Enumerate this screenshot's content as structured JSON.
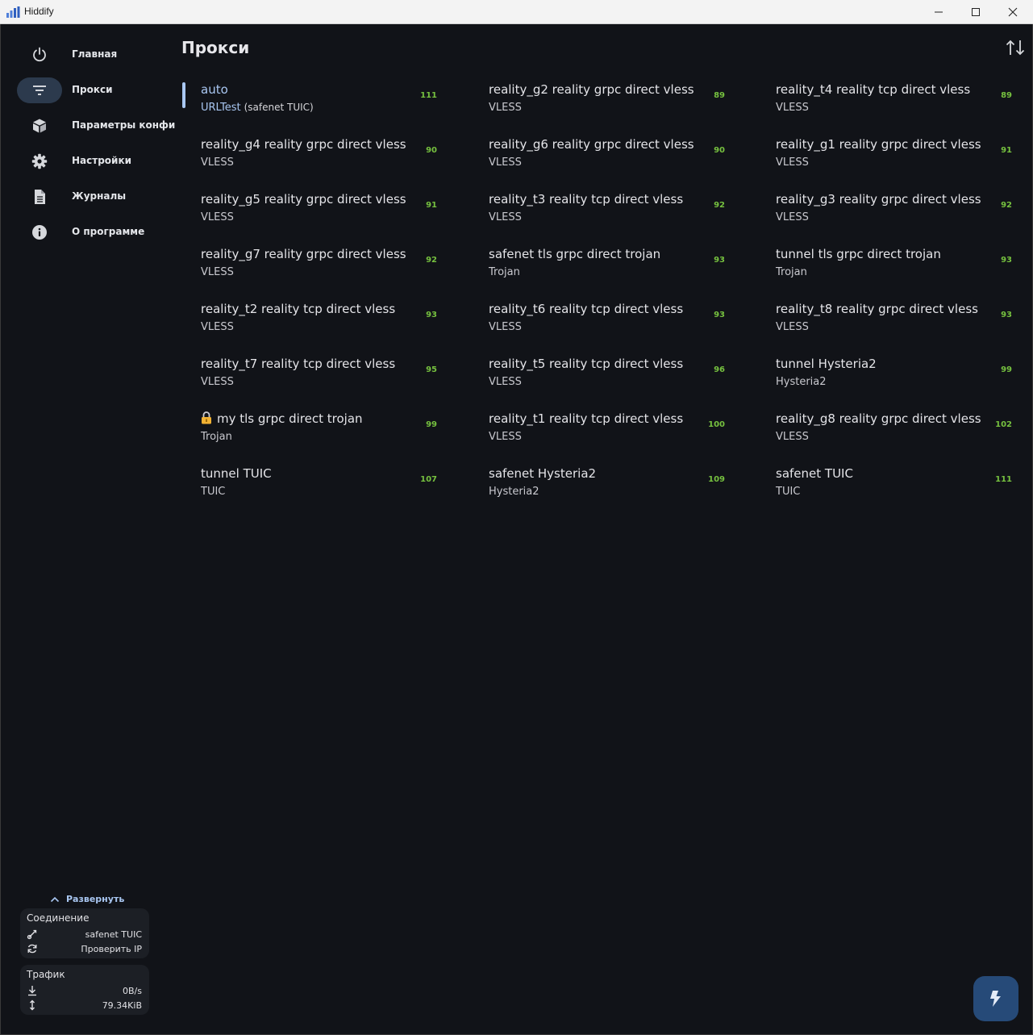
{
  "window": {
    "title": "Hiddify"
  },
  "sidebar": {
    "items": [
      {
        "label": "Главная",
        "icon": "power-icon",
        "active": false
      },
      {
        "label": "Прокси",
        "icon": "filter-icon",
        "active": true
      },
      {
        "label": "Параметры конфи",
        "icon": "cube-icon",
        "active": false
      },
      {
        "label": "Настройки",
        "icon": "gear-icon",
        "active": false
      },
      {
        "label": "Журналы",
        "icon": "document-icon",
        "active": false
      },
      {
        "label": "О программе",
        "icon": "info-icon",
        "active": false
      }
    ],
    "expand_label": "Развернуть",
    "connection": {
      "title": "Соединение",
      "proxy": "safenet TUIC",
      "check_ip": "Проверить IP"
    },
    "traffic": {
      "title": "Трафик",
      "speed": "0B/s",
      "total": "79.34KiB"
    }
  },
  "main": {
    "title": "Прокси",
    "proxies": [
      {
        "name": "auto",
        "type": "URLTest",
        "sub": "(safenet TUIC)",
        "delay": "111",
        "selected": true
      },
      {
        "name": "reality_g2 reality grpc direct vless",
        "type": "VLESS",
        "delay": "89"
      },
      {
        "name": "reality_t4 reality tcp direct vless",
        "type": "VLESS",
        "delay": "89"
      },
      {
        "name": "reality_g4 reality grpc direct vless",
        "type": "VLESS",
        "delay": "90"
      },
      {
        "name": "reality_g6 reality grpc direct vless",
        "type": "VLESS",
        "delay": "90"
      },
      {
        "name": "reality_g1 reality grpc direct vless",
        "type": "VLESS",
        "delay": "91"
      },
      {
        "name": "reality_g5 reality grpc direct vless",
        "type": "VLESS",
        "delay": "91"
      },
      {
        "name": "reality_t3 reality tcp direct vless",
        "type": "VLESS",
        "delay": "92"
      },
      {
        "name": "reality_g3 reality grpc direct vless",
        "type": "VLESS",
        "delay": "92"
      },
      {
        "name": "reality_g7 reality grpc direct vless",
        "type": "VLESS",
        "delay": "92"
      },
      {
        "name": "safenet tls grpc direct trojan",
        "type": "Trojan",
        "delay": "93"
      },
      {
        "name": "tunnel tls grpc direct trojan",
        "type": "Trojan",
        "delay": "93"
      },
      {
        "name": "reality_t2 reality tcp direct vless",
        "type": "VLESS",
        "delay": "93"
      },
      {
        "name": "reality_t6 reality tcp direct vless",
        "type": "VLESS",
        "delay": "93"
      },
      {
        "name": "reality_t8 reality grpc direct vless",
        "type": "VLESS",
        "delay": "93"
      },
      {
        "name": "reality_t7 reality tcp direct vless",
        "type": "VLESS",
        "delay": "95"
      },
      {
        "name": "reality_t5 reality tcp direct vless",
        "type": "VLESS",
        "delay": "96"
      },
      {
        "name": "tunnel Hysteria2",
        "type": "Hysteria2",
        "delay": "99"
      },
      {
        "name": "my tls grpc direct trojan",
        "type": "Trojan",
        "delay": "99",
        "locked": true
      },
      {
        "name": "reality_t1 reality tcp direct vless",
        "type": "VLESS",
        "delay": "100"
      },
      {
        "name": "reality_g8 reality grpc direct vless",
        "type": "VLESS",
        "delay": "102"
      },
      {
        "name": "tunnel TUIC",
        "type": "TUIC",
        "delay": "107"
      },
      {
        "name": "safenet Hysteria2",
        "type": "Hysteria2",
        "delay": "109"
      },
      {
        "name": "safenet TUIC",
        "type": "TUIC",
        "delay": "111"
      }
    ]
  },
  "fab": {
    "icon": "lightning-icon"
  },
  "colors": {
    "accent": "#a9c7f2",
    "delay_good": "#76c13f",
    "background": "#111318",
    "fab": "#264a78"
  }
}
